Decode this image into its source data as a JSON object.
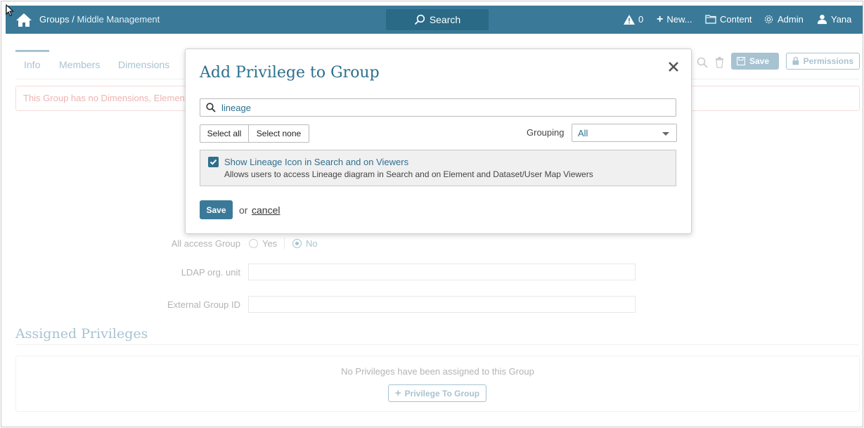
{
  "topbar": {
    "breadcrumb_root": "Groups",
    "breadcrumb_sep": " / ",
    "breadcrumb_current": "Middle Management",
    "search_label": "Search",
    "alerts_count": "0",
    "new_label": "New...",
    "content_label": "Content",
    "admin_label": "Admin",
    "user_label": "Yana",
    "bar_color": "#3a7a98"
  },
  "tabs": [
    "Info",
    "Members",
    "Dimensions"
  ],
  "warning_text": "This Group has no Dimensions, Elemen",
  "toolbar": {
    "save_label": "Save",
    "permissions_label": "Permissions"
  },
  "form": {
    "all_access_label": "All access Group",
    "yes_label": "Yes",
    "no_label": "No",
    "ldap_label": "LDAP org. unit",
    "ldap_value": "",
    "external_label": "External Group ID",
    "external_value": ""
  },
  "assigned": {
    "title": "Assigned Privileges",
    "empty_text": "No Privileges have been assigned to this Group",
    "add_button": "Privilege To Group"
  },
  "modal": {
    "title": "Add Privilege to Group",
    "search_value": "lineage",
    "select_all": "Select all",
    "select_none": "Select none",
    "grouping_label": "Grouping",
    "grouping_value": "All",
    "privilege_name": "Show Lineage Icon in Search and on Viewers",
    "privilege_desc": "Allows users to access Lineage diagram in Search and on Element and Dataset/User Map Viewers",
    "privilege_checked": true,
    "save_label": "Save",
    "or_text": "or",
    "cancel_label": "cancel"
  }
}
